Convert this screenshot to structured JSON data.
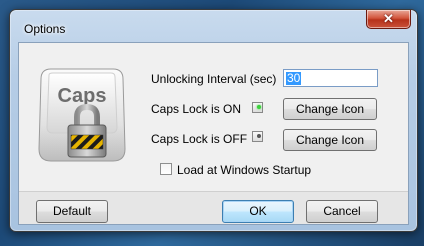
{
  "window": {
    "title": "Options"
  },
  "icon": {
    "name": "caps-lock-icon",
    "text": "Caps"
  },
  "interval": {
    "label": "Unlocking Interval (sec)",
    "value": "30"
  },
  "caps_on": {
    "label": "Caps Lock is ON",
    "button": "Change Icon",
    "indicator_color": "#3cd23c"
  },
  "caps_off": {
    "label": "Caps Lock is OFF",
    "button": "Change Icon",
    "indicator_color": "#555555"
  },
  "startup": {
    "label": "Load at Windows Startup",
    "checked": false
  },
  "buttons": {
    "default": "Default",
    "ok": "OK",
    "cancel": "Cancel"
  },
  "colors": {
    "accent": "#3399ff",
    "close": "#c9452d"
  }
}
